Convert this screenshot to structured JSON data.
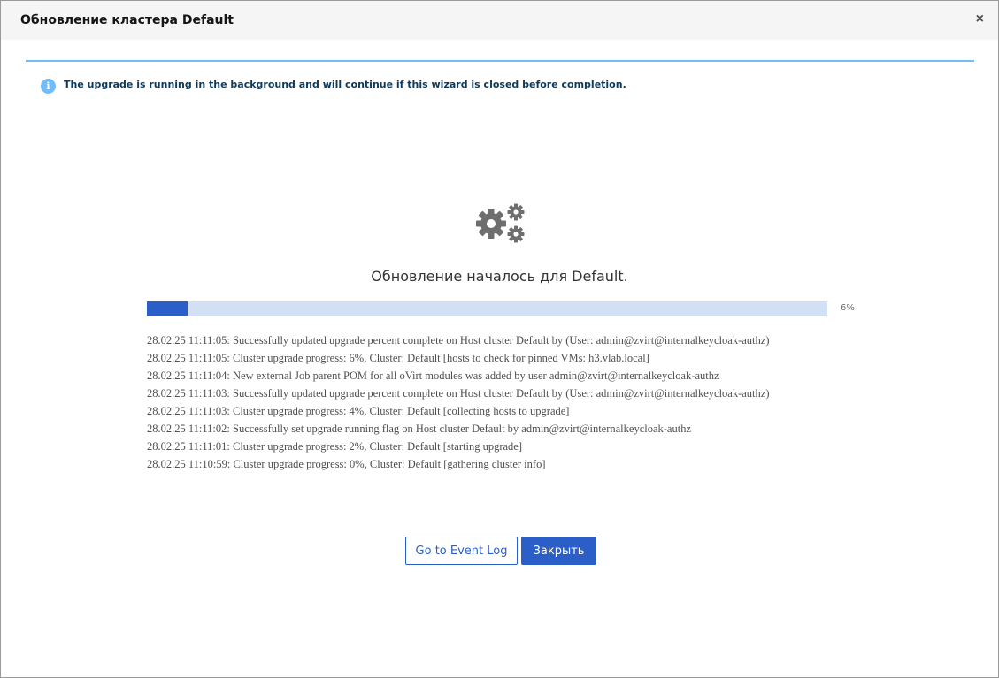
{
  "modal": {
    "title": "Обновление кластера Default",
    "close_label": "×"
  },
  "alert": {
    "icon": "info-icon",
    "glyph": "i",
    "text": "The upgrade is running in the background and will continue if this wizard is closed before completion.",
    "color": "#73bcf7"
  },
  "status": {
    "icon": "gears-icon",
    "title": "Обновление началось для Default."
  },
  "progress": {
    "percent": 6,
    "label": "6%",
    "fill_color": "#2b5fc7",
    "track_color": "#d2e0f5"
  },
  "log": [
    "28.02.25 11:11:05: Successfully updated upgrade percent complete on Host cluster Default by (User: admin@zvirt@internalkeycloak-authz)",
    "28.02.25 11:11:05: Cluster upgrade progress: 6%, Cluster: Default [hosts to check for pinned VMs: h3.vlab.local]",
    "28.02.25 11:11:04: New external Job parent POM for all oVirt modules was added by user admin@zvirt@internalkeycloak-authz",
    "28.02.25 11:11:03: Successfully updated upgrade percent complete on Host cluster Default by (User: admin@zvirt@internalkeycloak-authz)",
    "28.02.25 11:11:03: Cluster upgrade progress: 4%, Cluster: Default [collecting hosts to upgrade]",
    "28.02.25 11:11:02: Successfully set upgrade running flag on Host cluster Default by admin@zvirt@internalkeycloak-authz",
    "28.02.25 11:11:01: Cluster upgrade progress: 2%, Cluster: Default [starting upgrade]",
    "28.02.25 11:10:59: Cluster upgrade progress: 0%, Cluster: Default [gathering cluster info]"
  ],
  "buttons": {
    "event_log": "Go to Event Log",
    "close": "Закрыть"
  }
}
